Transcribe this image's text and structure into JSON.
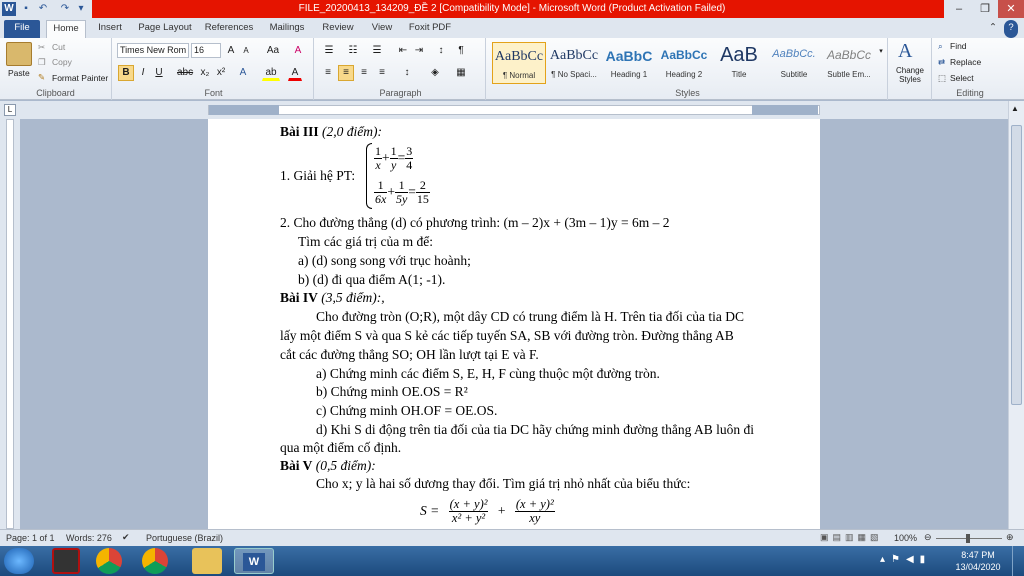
{
  "window": {
    "title": "FILE_20200413_134209_ĐỀ 2 [Compatibility Mode]  -  Microsoft Word (Product Activation Failed)",
    "min": "–",
    "max": "❐",
    "close": "✕"
  },
  "tabs": [
    "File",
    "Home",
    "Insert",
    "Page Layout",
    "References",
    "Mailings",
    "Review",
    "View",
    "Foxit PDF"
  ],
  "clipboard": {
    "paste": "Paste",
    "cut": "Cut",
    "copy": "Copy",
    "format_painter": "Format Painter",
    "label": "Clipboard"
  },
  "font": {
    "name": "Times New Rom",
    "size": "16",
    "label": "Font"
  },
  "paragraph": {
    "label": "Paragraph"
  },
  "styles": {
    "label": "Styles",
    "items": [
      {
        "preview": "AaBbCc",
        "name": "¶ Normal"
      },
      {
        "preview": "AaBbCc",
        "name": "¶ No Spaci..."
      },
      {
        "preview": "AaBbC",
        "name": "Heading 1"
      },
      {
        "preview": "AaBbCc",
        "name": "Heading 2"
      },
      {
        "preview": "AaB",
        "name": "Title"
      },
      {
        "preview": "AaBbCc.",
        "name": "Subtitle"
      },
      {
        "preview": "AaBbCc",
        "name": "Subtle Em..."
      }
    ],
    "change": "Change Styles"
  },
  "editing": {
    "find": "Find",
    "replace": "Replace",
    "select": "Select",
    "label": "Editing"
  },
  "doc": {
    "l1_b": "Bài III",
    "l1_i": " (2,0 điểm):",
    "l2_pre": "1. Giải hệ PT:",
    "eq1": {
      "a_n": "1",
      "a_d": "x",
      "b_n": "1",
      "b_d": "y",
      "c_n": "3",
      "c_d": "4"
    },
    "eq2": {
      "a_n": "1",
      "a_d": "6x",
      "b_n": "1",
      "b_d": "5y",
      "c_n": "2",
      "c_d": "15"
    },
    "l3": "2. Cho đường thẳng (d) có phương trình: (m – 2)x + (3m – 1)y = 6m – 2",
    "l4": "Tìm các giá trị của m để:",
    "l5": "a)  (d) song song với trục hoành;",
    "l6": "b)  (d) đi qua điểm A(1; -1).",
    "l7_b": "Bài IV",
    "l7_i": " (3,5 điểm):,",
    "l8": "Cho đường tròn (O;R), một dây CD có trung điểm là H. Trên tia đối của tia DC",
    "l9": "lấy một điểm S và qua S kẻ các tiếp tuyến SA, SB với đường tròn. Đường thẳng AB",
    "l10": "cắt các đường thẳng SO; OH lần lượt tại E và F.",
    "l11": "a) Chứng minh các điểm S, E, H, F cùng thuộc một đường tròn.",
    "l12": "b) Chứng minh OE.OS = R²",
    "l13": "c) Chứng minh OH.OF = OE.OS.",
    "l14": "d) Khi S di động trên tia đối của tia DC hãy chứng minh đường thẳng AB luôn đi",
    "l15": "qua một điểm cố định.",
    "l16_b": "Bài V",
    "l16_i": " (0,5 điểm):",
    "l17": "Cho x; y là hai số dương thay đổi. Tìm giá trị nhỏ nhất của biểu thức:",
    "s_lhs": "S  =",
    "s_t1_n": "(x + y)²",
    "s_t1_d": "x² + y²",
    "s_plus": "+",
    "s_t2_n": "(x + y)²",
    "s_t2_d": "xy"
  },
  "status": {
    "page": "Page: 1 of 1",
    "words": "Words: 276",
    "lang": "Portuguese (Brazil)",
    "zoom": "100%"
  },
  "clock": {
    "time": "8:47 PM",
    "date": "13/04/2020"
  }
}
